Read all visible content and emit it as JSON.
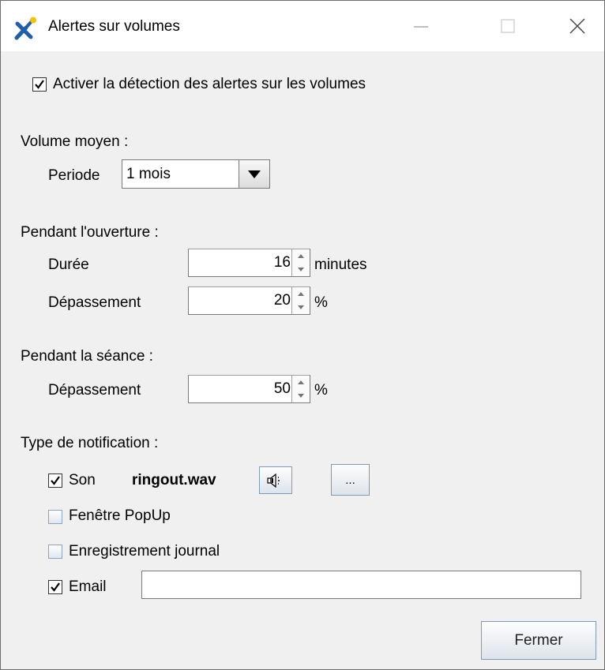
{
  "window": {
    "title": "Alertes sur volumes"
  },
  "activation": {
    "label": "Activer la détection des alertes sur les volumes",
    "checked": true
  },
  "volume_moyen": {
    "heading": "Volume moyen :",
    "periode_label": "Periode",
    "periode_value": "1 mois"
  },
  "ouverture": {
    "heading": "Pendant l'ouverture :",
    "duree_label": "Durée",
    "duree_value": "16",
    "duree_unit": "minutes",
    "depassement_label": "Dépassement",
    "depassement_value": "20",
    "depassement_unit": "%"
  },
  "seance": {
    "heading": "Pendant la séance :",
    "depassement_label": "Dépassement",
    "depassement_value": "50",
    "depassement_unit": "%"
  },
  "notification": {
    "heading": "Type de notification :",
    "son_label": "Son",
    "son_checked": true,
    "son_file": "ringout.wav",
    "browse_label": "...",
    "popup_label": "Fenêtre PopUp",
    "popup_checked": false,
    "journal_label": "Enregistrement journal",
    "journal_checked": false,
    "email_label": "Email",
    "email_checked": true,
    "email_value": ""
  },
  "actions": {
    "close_label": "Fermer"
  },
  "icons": {
    "app": "x-logo-icon",
    "minimize": "minimize-icon",
    "maximize": "maximize-icon",
    "close": "close-icon",
    "dropdown": "triangle-down-icon",
    "speaker": "speaker-icon"
  },
  "colors": {
    "window_bg": "#f0f0f0",
    "titlebar_bg": "#ffffff",
    "button_border": "#7e9ab9",
    "logo_blue": "#1f5fa8",
    "logo_yellow": "#f2c200"
  }
}
